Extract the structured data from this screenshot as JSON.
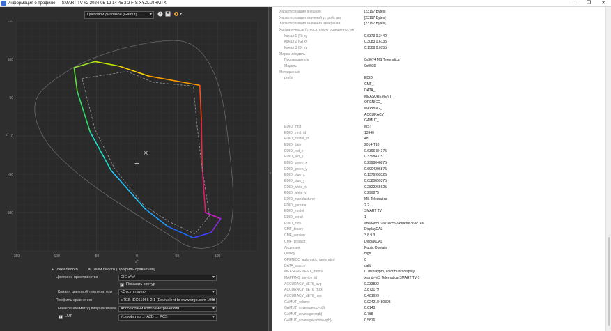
{
  "window": {
    "title": "Информация о профиле — SMART TV #2 2024-05-12 14-45 2.2 F-S XYZLUT+MTX",
    "minimize": "–",
    "maximize": "❐",
    "close": "✕"
  },
  "toolbar": {
    "view_select": "Цветовой диапазон (Gamut)",
    "help_icon": "help-icon",
    "save_icon": "save-icon",
    "settings_icon": "settings-icon"
  },
  "chart_data": {
    "type": "scatter",
    "title": "",
    "xlabel": "a*",
    "ylabel": "b*",
    "xlim": [
      -150,
      150
    ],
    "ylim": [
      -150,
      150
    ],
    "x_ticks": [
      -150,
      -100,
      -50,
      0,
      50,
      100
    ],
    "y_ticks": [
      150,
      100,
      50,
      0,
      -50,
      -100
    ],
    "grid": true,
    "series": [
      {
        "role": "profile gamut outline",
        "style": "solid rainbow",
        "points": [
          [
            -78,
            89
          ],
          [
            -52,
            97
          ],
          [
            -22,
            91
          ],
          [
            15,
            78
          ],
          [
            78,
            66
          ],
          [
            80,
            20
          ],
          [
            81,
            -40
          ],
          [
            85,
            -100
          ],
          [
            104,
            -108
          ],
          [
            92,
            -126
          ],
          [
            70,
            -133
          ],
          [
            38,
            -118
          ],
          [
            10,
            -95
          ],
          [
            -32,
            -45
          ],
          [
            -58,
            5
          ],
          [
            -74,
            58
          ],
          [
            -78,
            89
          ]
        ]
      },
      {
        "role": "comparison profile gamut outline",
        "style": "dashed gray",
        "points": [
          [
            -68,
            75
          ],
          [
            -12,
            84
          ],
          [
            20,
            70
          ],
          [
            70,
            65
          ],
          [
            74,
            20
          ],
          [
            80,
            -35
          ],
          [
            90,
            -104
          ],
          [
            72,
            -128
          ],
          [
            40,
            -112
          ],
          [
            8,
            -90
          ],
          [
            -28,
            -42
          ],
          [
            -52,
            8
          ],
          [
            -68,
            75
          ]
        ]
      },
      {
        "role": "whitepoint profile",
        "style": "plus",
        "points": [
          [
            0,
            -36
          ]
        ]
      },
      {
        "role": "whitepoint comparison",
        "style": "cross",
        "points": [
          [
            11,
            -22
          ]
        ]
      }
    ]
  },
  "controls": {
    "whitepoints_label": "Точки белого",
    "whitepoints_comparison_label": "Точки белого (Профиль сравнения)",
    "color_space_label": "Цветовое пространство",
    "color_space_value": "CIE a*b*",
    "show_outline_label": "Показать контур",
    "show_outline_checked": true,
    "temp_curve_label": "Кривая цветовой температуры",
    "temp_curve_value": "<Отсутствует>",
    "comparison_profile_label": "Профиль сравнения",
    "comparison_profile_value": "sRGB IEC61966-2.1 (Equivalent to www.srgb.com 1998",
    "intent_label": "Намерение/метод визуализации",
    "intent_value": "Абсолютный колориметрический",
    "lut_label": "LUT",
    "lut_checked": true,
    "lut_value": "Устройство → A2B → PCS"
  },
  "properties": [
    {
      "key": "Характеризация внешняя",
      "value": "[23197 Bytes]",
      "sub": false
    },
    {
      "key": "Характеризация значений устройства",
      "value": "[23197 Bytes]",
      "sub": false
    },
    {
      "key": "Характеризация значений измерений",
      "value": "[23197 Bytes]",
      "sub": false
    },
    {
      "key": "Хроматичность (относительно освещенности)",
      "value": "",
      "sub": false
    },
    {
      "key": "Канал 1 (R) xy",
      "value": "0.6373 0.3442",
      "sub": true
    },
    {
      "key": "Канал 2 (G) xy",
      "value": "0.3083 0.6135",
      "sub": true
    },
    {
      "key": "Канал 3 (B) xy",
      "value": "0.1508 0.0755",
      "sub": true
    },
    {
      "key": "Марка и модель",
      "value": "",
      "sub": false
    },
    {
      "key": "Производитель",
      "value": "0x3674 MS Telematica",
      "sub": true
    },
    {
      "key": "Модель",
      "value": "0x0030",
      "sub": true
    },
    {
      "key": "Метаданные",
      "value": "",
      "sub": false
    },
    {
      "key": "prefix",
      "value": "EDID_",
      "sub": true
    },
    {
      "key": "",
      "value": "CMF_",
      "sub": true
    },
    {
      "key": "",
      "value": "DATA_",
      "sub": true
    },
    {
      "key": "",
      "value": "MEASUREMENT_",
      "sub": true
    },
    {
      "key": "",
      "value": "OPENICC_",
      "sub": true
    },
    {
      "key": "",
      "value": "MAPPING_",
      "sub": true
    },
    {
      "key": "",
      "value": "ACCURACY_",
      "sub": true
    },
    {
      "key": "",
      "value": "GAMUT_",
      "sub": true
    },
    {
      "key": "EDID_mnft",
      "value": "MST",
      "sub": true
    },
    {
      "key": "EDID_mnft_id",
      "value": "13940",
      "sub": true
    },
    {
      "key": "EDID_model_id",
      "value": "48",
      "sub": true
    },
    {
      "key": "EDID_date",
      "value": "2014-T10",
      "sub": true
    },
    {
      "key": "EDID_red_x",
      "value": "0.6396484375",
      "sub": true
    },
    {
      "key": "EDID_red_y",
      "value": "0.33984375",
      "sub": true
    },
    {
      "key": "EDID_green_x",
      "value": "0.2998046875",
      "sub": true
    },
    {
      "key": "EDID_green_y",
      "value": "0.6904296875",
      "sub": true
    },
    {
      "key": "EDID_blue_x",
      "value": "0.1376953125",
      "sub": true
    },
    {
      "key": "EDID_blue_y",
      "value": "0.0380859375",
      "sub": true
    },
    {
      "key": "EDID_white_x",
      "value": "0.2822265625",
      "sub": true
    },
    {
      "key": "EDID_white_y",
      "value": "0.296875",
      "sub": true
    },
    {
      "key": "EDID_manufacturer",
      "value": "MS Telematica",
      "sub": true
    },
    {
      "key": "EDID_gamma",
      "value": "2.2",
      "sub": true
    },
    {
      "key": "EDID_model",
      "value": "SMART TV",
      "sub": true
    },
    {
      "key": "EDID_serial",
      "value": "1",
      "sub": true
    },
    {
      "key": "EDID_md5",
      "value": "ab084dc1f7a20ed59249def0c36ac1e6",
      "sub": true
    },
    {
      "key": "CMF_binary",
      "value": "DisplayCAL",
      "sub": true
    },
    {
      "key": "CMF_version",
      "value": "3.8.9.3",
      "sub": true
    },
    {
      "key": "CMF_product",
      "value": "DisplayCAL",
      "sub": true
    },
    {
      "key": "Лицензия",
      "value": "Public Domain",
      "sub": true
    },
    {
      "key": "Quality",
      "value": "high",
      "sub": true
    },
    {
      "key": "OPENICC_automatic_generated",
      "value": "0",
      "sub": true
    },
    {
      "key": "DATA_source",
      "value": "calib",
      "sub": true
    },
    {
      "key": "MEASUREMENT_device",
      "value": "i1 displaypro, colormunki display",
      "sub": true
    },
    {
      "key": "MAPPING_device_id",
      "value": "xrandr-MS Telematica-SMART TV-1",
      "sub": true
    },
    {
      "key": "ACCURACY_dE76_avg",
      "value": "0.233822",
      "sub": true
    },
    {
      "key": "ACCURACY_dE76_max",
      "value": "3.873179",
      "sub": true
    },
    {
      "key": "ACCURACY_dE76_rms",
      "value": "0.481699",
      "sub": true
    },
    {
      "key": "GAMUT_volume",
      "value": "0.924218480398",
      "sub": true
    },
    {
      "key": "GAMUT_coverage(dci-p3)",
      "value": "0.6143",
      "sub": true
    },
    {
      "key": "GAMUT_coverage(srgb)",
      "value": "0.788",
      "sub": true
    },
    {
      "key": "GAMUT_coverage(adobe-rgb)",
      "value": "0.5816",
      "sub": true
    }
  ]
}
